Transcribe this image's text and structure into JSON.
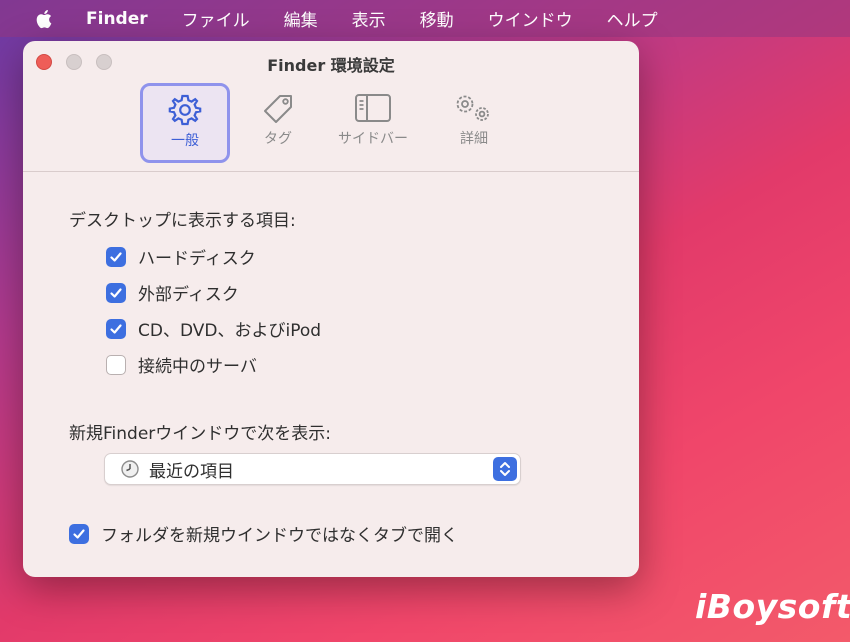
{
  "menubar": {
    "items": [
      "Finder",
      "ファイル",
      "編集",
      "表示",
      "移動",
      "ウインドウ",
      "ヘルプ"
    ]
  },
  "window": {
    "title": "Finder 環境設定",
    "tabs": [
      {
        "label": "一般",
        "icon": "gear-icon",
        "active": true
      },
      {
        "label": "タグ",
        "icon": "tag-icon",
        "active": false
      },
      {
        "label": "サイドバー",
        "icon": "sidebar-icon",
        "active": false
      },
      {
        "label": "詳細",
        "icon": "gears-icon",
        "active": false
      }
    ],
    "desktop_section": {
      "label": "デスクトップに表示する項目:",
      "items": [
        {
          "label": "ハードディスク",
          "checked": true
        },
        {
          "label": "外部ディスク",
          "checked": true
        },
        {
          "label": "CD、DVD、およびiPod",
          "checked": true
        },
        {
          "label": "接続中のサーバ",
          "checked": false
        }
      ]
    },
    "new_window_section": {
      "label": "新規Finderウインドウで次を表示:",
      "selected": "最近の項目"
    },
    "open_in_tabs": {
      "label": "フォルダを新規ウインドウではなくタブで開く",
      "checked": true
    }
  },
  "watermark": "iBoysoft",
  "colors": {
    "accent": "#3d6fe0",
    "active_tab_border": "#8f93ec",
    "close_button": "#ee5d58"
  }
}
